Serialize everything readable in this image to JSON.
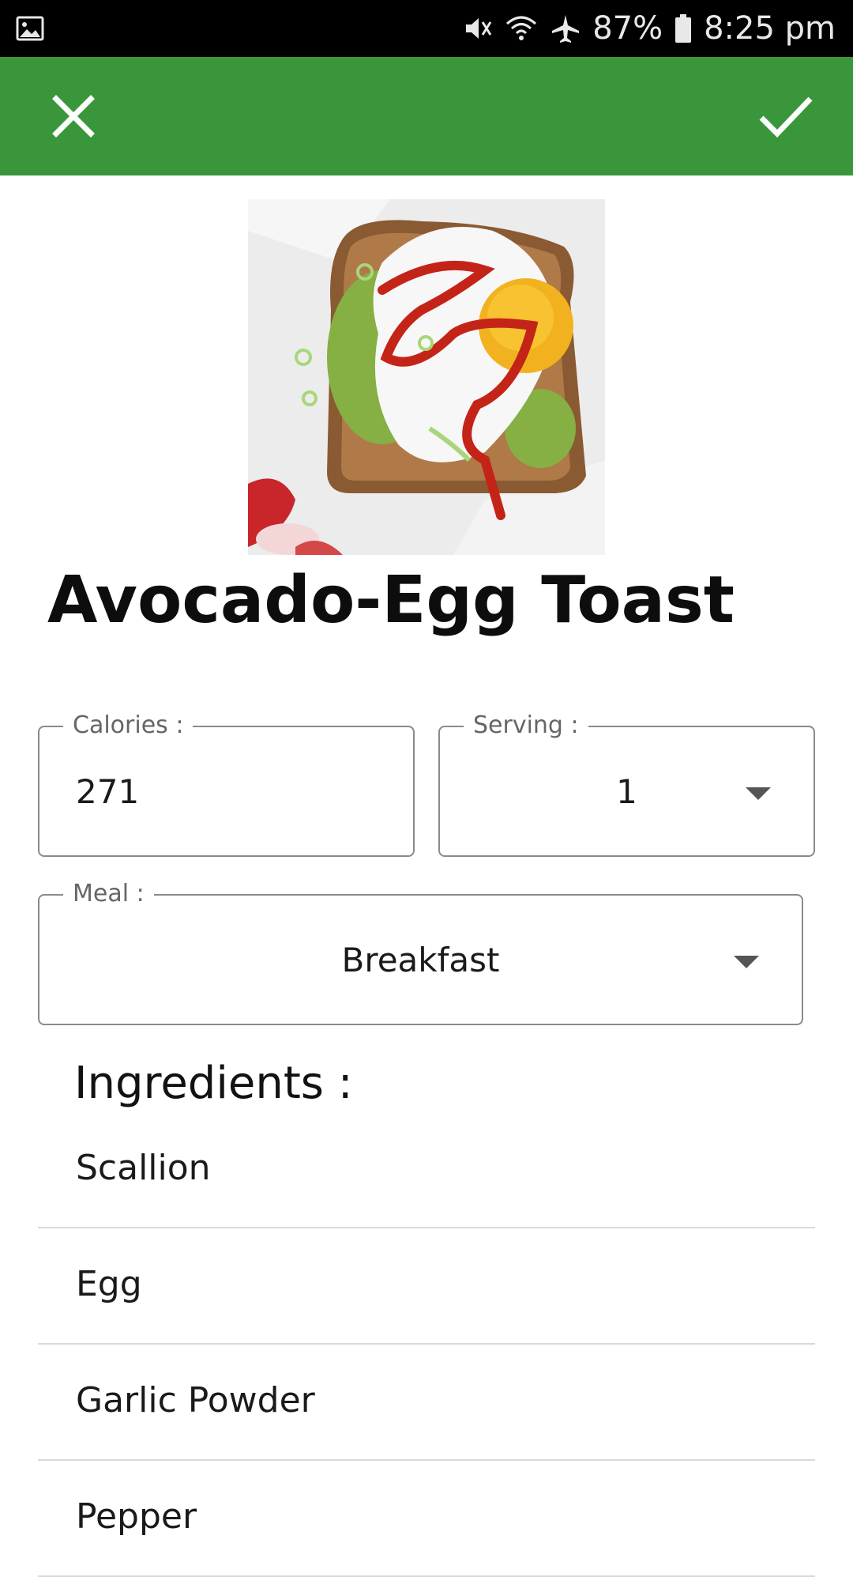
{
  "status_bar": {
    "battery": "87%",
    "time": "8:25 pm",
    "icons": [
      "gallery-icon",
      "mute-icon",
      "wifi-icon",
      "airplane-icon",
      "battery-icon"
    ]
  },
  "app_bar": {
    "color": "#3a963a",
    "close_icon": "close-icon",
    "confirm_icon": "check-icon"
  },
  "recipe": {
    "title": "Avocado-Egg Toast",
    "calories_label": "Calories :",
    "calories_value": "271",
    "serving_label": "Serving :",
    "serving_value": "1",
    "meal_label": "Meal :",
    "meal_value": "Breakfast"
  },
  "ingredients": {
    "heading": "Ingredients :",
    "items": [
      {
        "name": "Scallion"
      },
      {
        "name": "Egg"
      },
      {
        "name": "Garlic Powder"
      },
      {
        "name": "Pepper"
      }
    ]
  }
}
